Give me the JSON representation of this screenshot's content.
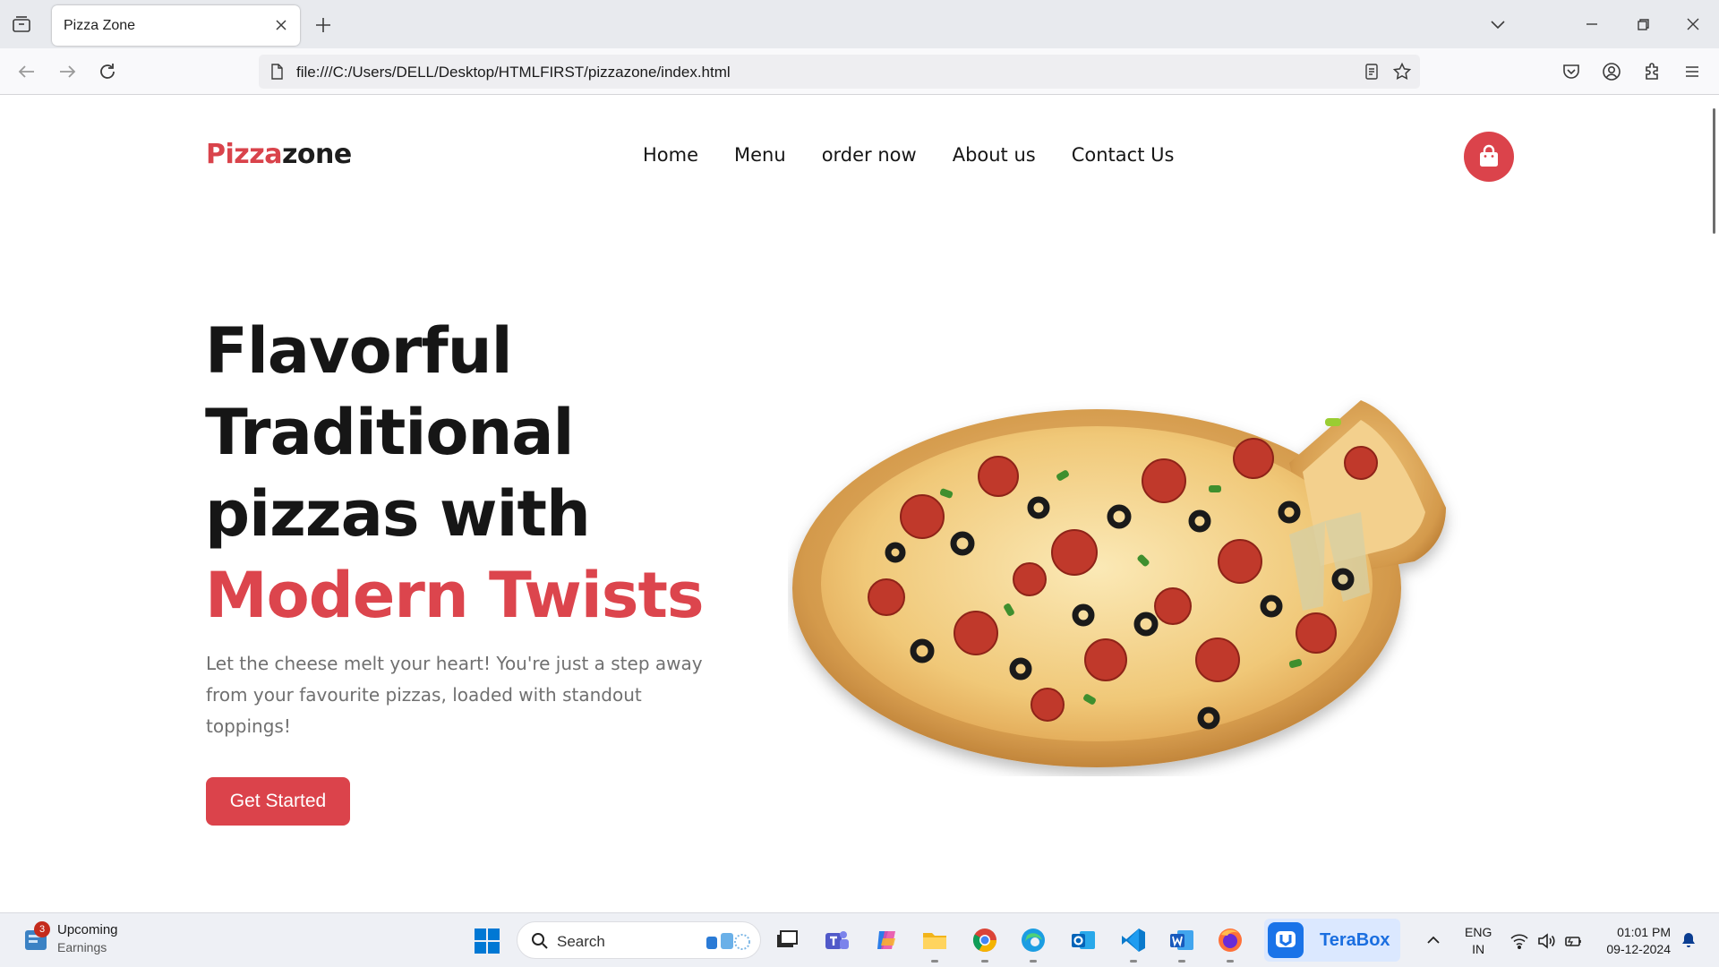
{
  "browser": {
    "tab_title": "Pizza Zone",
    "url": "file:///C:/Users/DELL/Desktop/HTMLFIRST/pizzazone/index.html"
  },
  "site": {
    "logo_part1": "Pizza",
    "logo_part2": "zone",
    "nav": [
      "Home",
      "Menu",
      "order now",
      "About us",
      "Contact Us"
    ],
    "hero": {
      "line1": "Flavorful",
      "line2": "Traditional",
      "line3": "pizzas with",
      "line4": "Modern Twists",
      "subtitle": "Let the cheese melt your heart! You're just a step away from your favourite pizzas, loaded with standout toppings!",
      "cta": "Get Started"
    }
  },
  "taskbar": {
    "widget_badge": "3",
    "widget_title": "Upcoming",
    "widget_sub": "Earnings",
    "search_placeholder": "Search",
    "terabox_label": "TeraBox",
    "lang_line1": "ENG",
    "lang_line2": "IN",
    "time": "01:01 PM",
    "date": "09-12-2024"
  },
  "colors": {
    "accent": "#db434b",
    "text_dark": "#161616",
    "text_muted": "#707070"
  },
  "icons": [
    "tab-list-icon",
    "close-icon",
    "plus-icon",
    "chevron-down-icon",
    "minimize-icon",
    "restore-icon",
    "back-arrow-icon",
    "forward-arrow-icon",
    "reload-icon",
    "page-icon",
    "reader-view-icon",
    "star-icon",
    "pocket-icon",
    "account-icon",
    "extensions-icon",
    "menu-icon",
    "shopping-bag-icon",
    "windows-start-icon",
    "search-icon",
    "wifi-icon",
    "speaker-icon",
    "battery-icon",
    "bell-icon"
  ]
}
